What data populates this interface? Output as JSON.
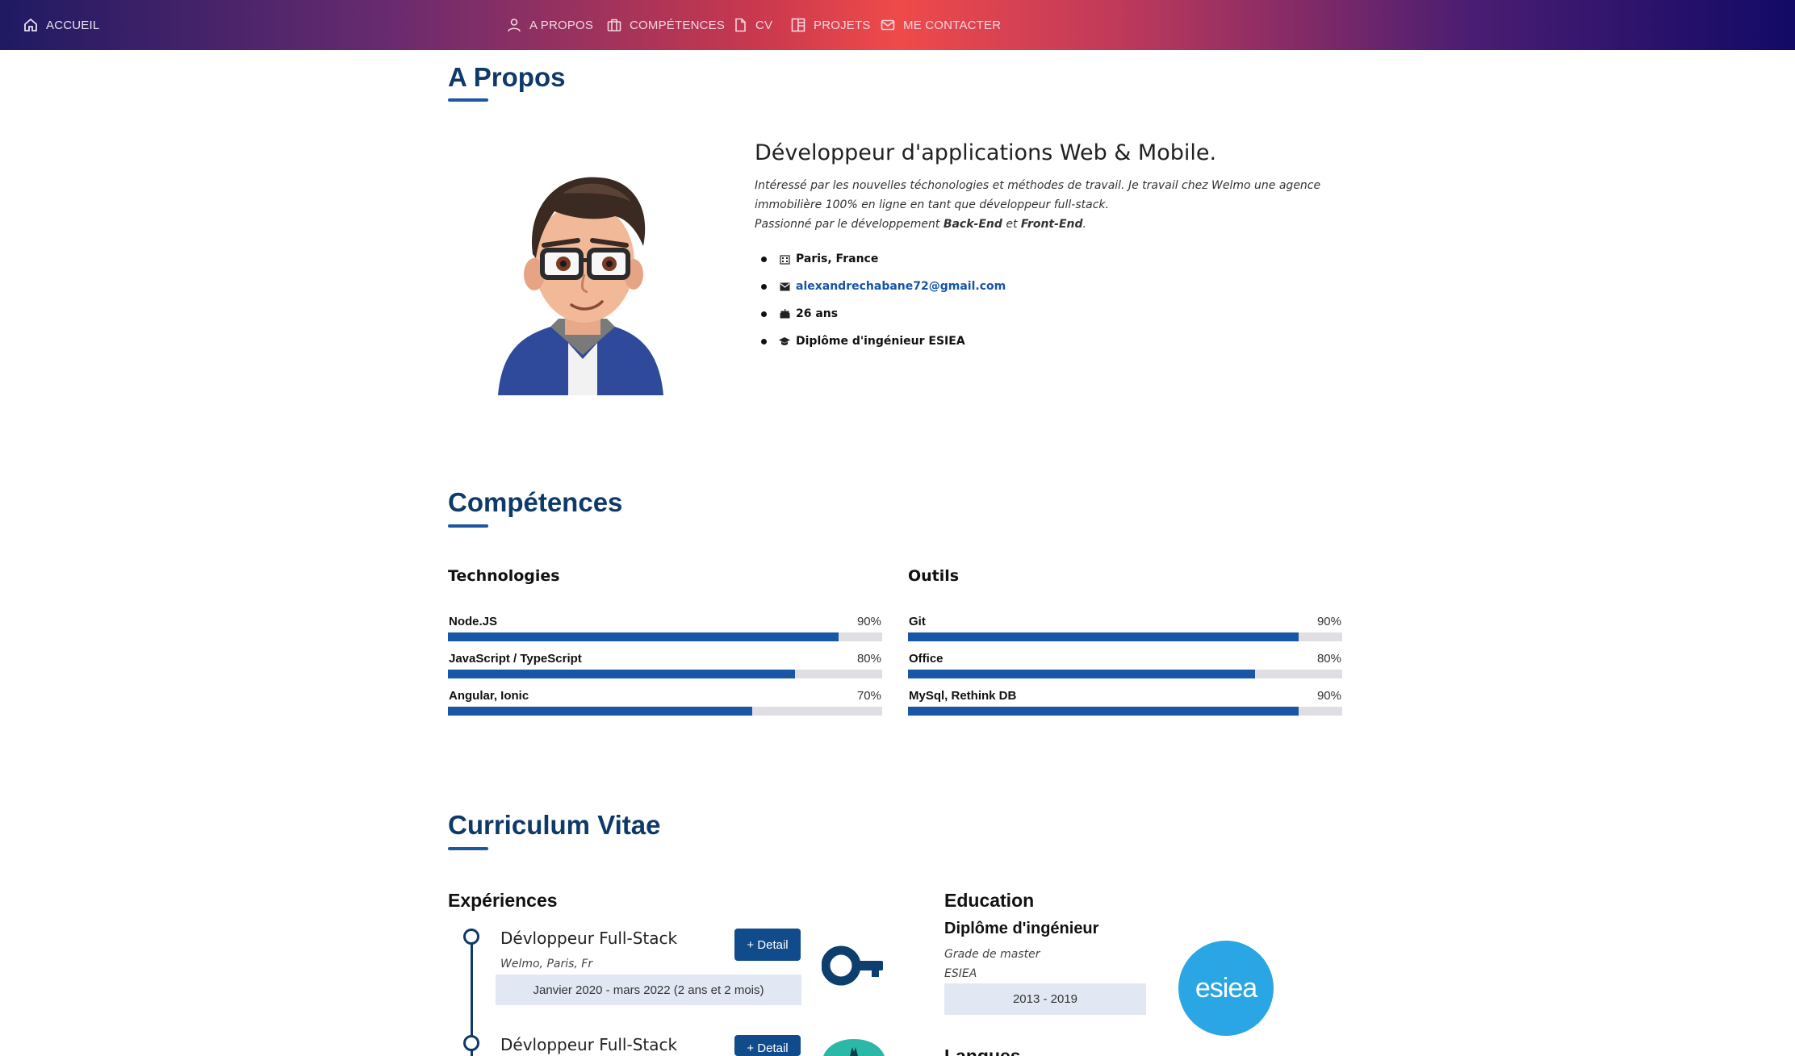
{
  "nav": {
    "home": "ACCUEIL",
    "items": [
      {
        "label": "A PROPOS",
        "icon": "person-icon"
      },
      {
        "label": "COMPÉTENCES",
        "icon": "briefcase-icon"
      },
      {
        "label": "CV",
        "icon": "document-icon"
      },
      {
        "label": "PROJETS",
        "icon": "columns-icon"
      },
      {
        "label": "ME CONTACTER",
        "icon": "envelope-icon"
      }
    ]
  },
  "about": {
    "title": "A Propos",
    "heading": "Développeur d'applications Web & Mobile.",
    "text1": "Intéressé par les nouvelles téchonologies et méthodes de travail. Je travail chez Welmo une agence immobilière 100% en ligne en tant que développeur full-stack.",
    "text2_prefix": "Passionné par le développement ",
    "text2_backend": "Back-End",
    "text2_mid": " et ",
    "text2_frontend": "Front-End",
    "text2_suffix": ".",
    "info": {
      "location": "Paris, France",
      "email": "alexandrechabane72@gmail.com",
      "age": "26 ans",
      "degree": "Diplôme d'ingénieur ESIEA"
    }
  },
  "skills": {
    "title": "Compétences",
    "technologies": {
      "title": "Technologies",
      "items": [
        {
          "name": "Node.JS",
          "percent": "90%",
          "value": 0.9
        },
        {
          "name": "JavaScript / TypeScript",
          "percent": "80%",
          "value": 0.8
        },
        {
          "name": "Angular, Ionic",
          "percent": "70%",
          "value": 0.7
        }
      ]
    },
    "tools": {
      "title": "Outils",
      "items": [
        {
          "name": "Git",
          "percent": "90%",
          "value": 0.9
        },
        {
          "name": "Office",
          "percent": "80%",
          "value": 0.8
        },
        {
          "name": "MySql, Rethink DB",
          "percent": "90%",
          "value": 0.9
        }
      ]
    }
  },
  "cv": {
    "title": "Curriculum Vitae",
    "experiences_title": "Expériences",
    "jobs": [
      {
        "title": "Dévloppeur Full-Stack",
        "company": "Welmo, Paris, Fr",
        "dates": "Janvier 2020 - mars 2022 (2 ans et 2 mois)",
        "button": "+ Detail"
      },
      {
        "title": "Dévloppeur Full-Stack",
        "button": "+ Detail"
      }
    ],
    "education_title": "Education",
    "education": {
      "title": "Diplôme d'ingénieur",
      "line1": "Grade de master",
      "line2": "ESIEA",
      "dates": "2013 - 2019",
      "logo_text": "esiea"
    },
    "languages_title": "Langues"
  },
  "colors": {
    "accent": "#0e3a6a",
    "bar": "#1757a6",
    "esiea": "#2ba6e4",
    "welmo": "#0d3f6e"
  }
}
